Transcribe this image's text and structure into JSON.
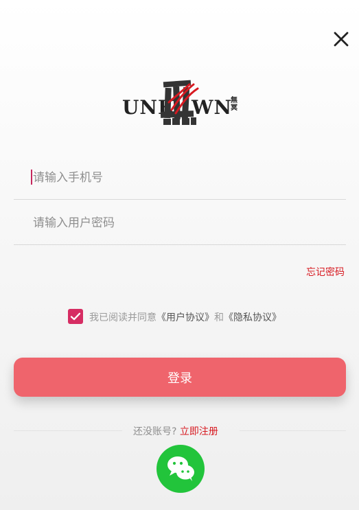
{
  "header": {
    "close_icon": "close-icon"
  },
  "logo": {
    "text_left": "UNK",
    "text_right": "WN",
    "chinese_mark": "無冥",
    "icon": "unknown-logo-mark"
  },
  "form": {
    "phone_placeholder": "请输入手机号",
    "phone_value": "",
    "password_placeholder": "请输入用户密码",
    "password_value": "",
    "forgot_password": "忘记密码"
  },
  "agreement": {
    "checked": true,
    "prefix": "我已阅读并同意",
    "user_agreement": "《用户协议》",
    "middle": "和",
    "privacy_policy": "《隐私协议》"
  },
  "actions": {
    "login_label": "登录"
  },
  "register": {
    "question": "还没账号?",
    "link": "立即注册"
  },
  "social": {
    "wechat_icon": "wechat-icon"
  },
  "colors": {
    "accent_red": "#d71920",
    "button_red": "#ef646c",
    "checkbox_pink": "#d62d63",
    "wechat_green": "#22c43b"
  }
}
